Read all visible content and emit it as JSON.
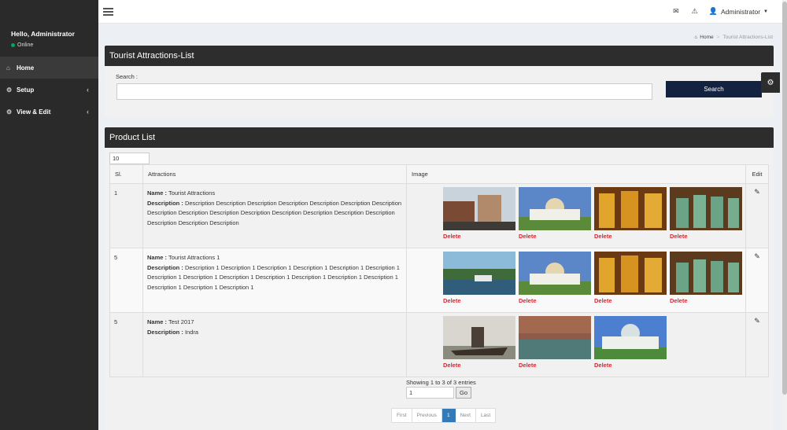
{
  "sidebar": {
    "greeting": "Hello, Administrator",
    "status": "Online",
    "items": [
      {
        "label": "Home",
        "icon": "home-icon"
      },
      {
        "label": "Setup",
        "icon": "gears-icon"
      },
      {
        "label": "View & Edit",
        "icon": "gears-icon"
      }
    ]
  },
  "header": {
    "user": "Administrator"
  },
  "breadcrumb": {
    "home": "Home",
    "current": "Tourist Attractions-List"
  },
  "search_box": {
    "title": "Tourist Attractions-List",
    "label": "Search :",
    "value": "",
    "button": "Search"
  },
  "product_list": {
    "title": "Product List",
    "page_size": "10",
    "columns": [
      "Sl.",
      "Attractions",
      "Image",
      "Edit"
    ],
    "rows": [
      {
        "sl": "1",
        "name_label": "Name :",
        "name": "Tourist Attractions",
        "desc_label": "Description :",
        "description": "Description Description Description Description Description Description Description Description Description Description Description Description Description Description Description Description Description Description",
        "delete_labels": [
          "Delete",
          "Delete",
          "Delete",
          "Delete"
        ]
      },
      {
        "sl": "5",
        "name_label": "Name :",
        "name": "Tourist Attractions 1",
        "desc_label": "Description :",
        "description": "Description 1 Description 1 Description 1 Description 1 Description 1 Description 1 Description 1 Description 1 Description 1 Description 1 Description 1 Description 1 Description 1 Description 1 Description 1 Description 1",
        "delete_labels": [
          "Delete",
          "Delete",
          "Delete",
          "Delete"
        ]
      },
      {
        "sl": "5",
        "name_label": "Name :",
        "name": "Test 2017",
        "desc_label": "Description :",
        "description": "Indra",
        "delete_labels": [
          "Delete",
          "Delete",
          "Delete"
        ]
      }
    ],
    "showing": "Showing 1 to 3 of 3 entries",
    "goto_value": "1",
    "go_button": "Go",
    "pagination": [
      "First",
      "Previous",
      "1",
      "Next",
      "Last"
    ]
  },
  "colors": {
    "sidebar": "#2a2a2a",
    "box_header": "#2d2d2d",
    "search_button": "#13233f",
    "delete": "#d9262f",
    "page_active": "#337ab7"
  }
}
